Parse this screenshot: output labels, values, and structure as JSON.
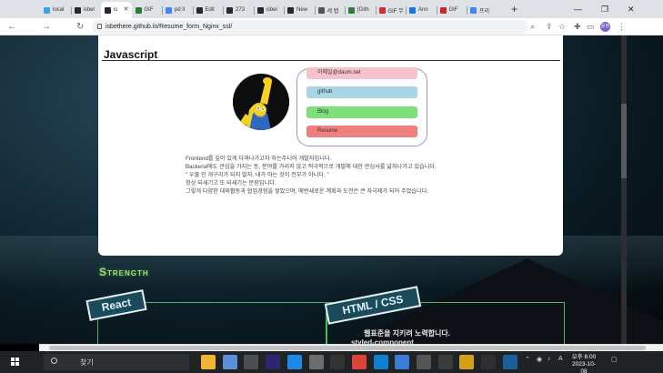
{
  "browser": {
    "tabs": [
      {
        "label": "local",
        "favicon_color": "#3aa3e3"
      },
      {
        "label": "isbel",
        "favicon_color": "#24292e"
      },
      {
        "label": "is",
        "favicon_color": "#24292e",
        "active": true
      },
      {
        "label": "GIF",
        "favicon_color": "#2e7d32"
      },
      {
        "label": "pd ll",
        "favicon_color": "#4285f4"
      },
      {
        "label": "Edit",
        "favicon_color": "#24292e"
      },
      {
        "label": "273",
        "favicon_color": "#24292e"
      },
      {
        "label": "isbel",
        "favicon_color": "#24292e"
      },
      {
        "label": "New",
        "favicon_color": "#24292e"
      },
      {
        "label": "세 탭",
        "favicon_color": "#555555"
      },
      {
        "label": "[Gith",
        "favicon_color": "#2e7d32"
      },
      {
        "label": "GIF 무",
        "favicon_color": "#d32f2f"
      },
      {
        "label": "Ann",
        "favicon_color": "#1a73e8"
      },
      {
        "label": "GIF",
        "favicon_color": "#c62828"
      },
      {
        "label": "프리",
        "favicon_color": "#4285f4"
      }
    ],
    "url": "isbethere.github.io/Resume_form_Nginx_ssl/",
    "new_tab": "+",
    "minimize": "—",
    "restore": "❐",
    "close": "✕",
    "back": "←",
    "forward": "→",
    "reload": "↻",
    "profile_initial": "윤정",
    "menu": "⋮"
  },
  "resume": {
    "section_title": "Javascript",
    "contacts": [
      {
        "label": "이메일@daum.net",
        "color": "#f7c2cc"
      },
      {
        "label": "github",
        "color": "#a9d5e5"
      },
      {
        "label": "Blog",
        "color": "#7ee07a"
      },
      {
        "label": "Resume",
        "color": "#f08080"
      }
    ],
    "intro": [
      "Frontend를 깊이 있게 다져나가고자 하는주니어 개발자입니다.",
      "Backend에도 관심을 가지는 등, 분야를 가리지 않고 적극적으로 개발에 대한 관심사를 넓혀나가고 있습니다.",
      "\" 우물 안 개구리가 되지 말자. 내가 아는 것이 전부가 아니다. \"",
      "항상 되새기고 또 되새기는 문장입니다.",
      "그렇게 다양한 대외활동과 협업경험을 쌓았으며, 매번새로운 계획과 도전은 큰 자극제가 되어 주었습니다."
    ],
    "strength_title": "Strength",
    "skills": [
      {
        "tag": "React"
      },
      {
        "tag": "HTML / CSS",
        "line1": "웹표준을 지키려 노력합니다.",
        "line2": "styled-component"
      }
    ]
  },
  "taskbar": {
    "search_placeholder": "찾기",
    "time": "오후 6:00",
    "date": "2023-10-08",
    "apps": [
      {
        "name": "file-explorer",
        "color": "#f2b632"
      },
      {
        "name": "notepad",
        "color": "#5b8fd6"
      },
      {
        "name": "settings",
        "color": "#4a4f55"
      },
      {
        "name": "premiere",
        "color": "#2a2770"
      },
      {
        "name": "photos",
        "color": "#1e88e5"
      },
      {
        "name": "media",
        "color": "#6d6d6d"
      },
      {
        "name": "terminal",
        "color": "#333333"
      },
      {
        "name": "chrome",
        "color": "#db4437"
      },
      {
        "name": "edge",
        "color": "#0f7fcf"
      },
      {
        "name": "store",
        "color": "#3a7bd5"
      },
      {
        "name": "app-a",
        "color": "#555555"
      },
      {
        "name": "app-b",
        "color": "#3b3b3b"
      },
      {
        "name": "app-c",
        "color": "#d4a017"
      },
      {
        "name": "app-d",
        "color": "#2f2f2f"
      },
      {
        "name": "app-e",
        "color": "#1b5e9b"
      }
    ]
  }
}
